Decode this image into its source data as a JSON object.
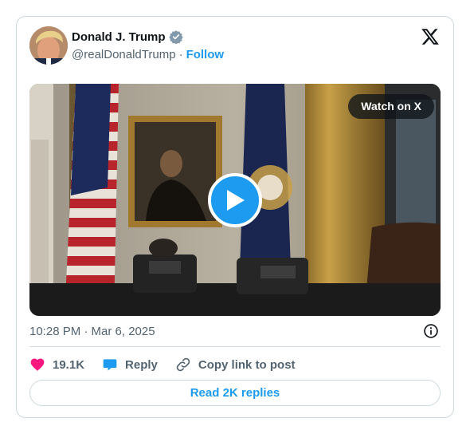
{
  "author": {
    "name": "Donald J. Trump",
    "handle": "@realDonaldTrump",
    "separator": "·",
    "follow_label": "Follow"
  },
  "media": {
    "watch_label": "Watch on X"
  },
  "meta": {
    "timestamp": "10:28 PM · Mar 6, 2025"
  },
  "actions": {
    "likes": "19.1K",
    "reply_label": "Reply",
    "copy_label": "Copy link to post"
  },
  "footer": {
    "read_replies_label": "Read 2K replies"
  },
  "colors": {
    "accent": "#1d9bf0",
    "like": "#f91880",
    "verified_badge": "#829aab"
  },
  "icons": [
    "verified-badge-icon",
    "x-logo-icon",
    "play-icon",
    "info-icon",
    "heart-icon",
    "reply-bubble-icon",
    "link-icon"
  ]
}
